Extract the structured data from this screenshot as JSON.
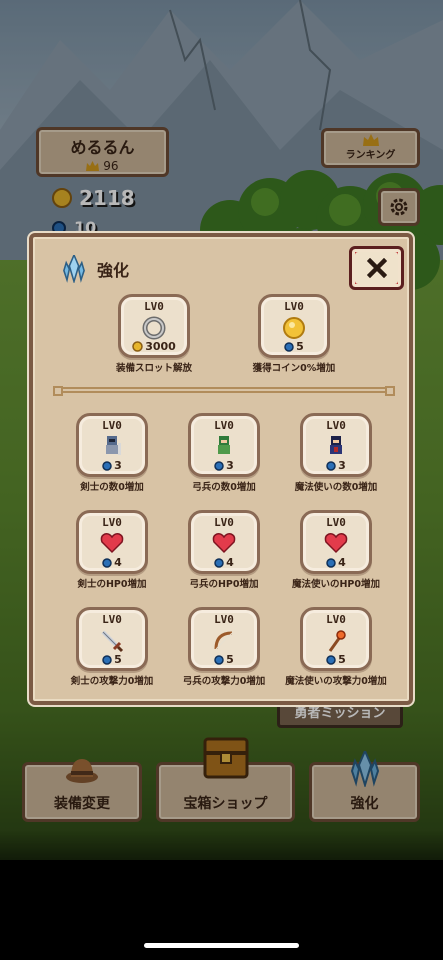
{
  "player": {
    "name": "めるるん",
    "level": "96"
  },
  "currency": {
    "coins": "2118",
    "gems": "10"
  },
  "ranking": {
    "label": "ランキング"
  },
  "mission": {
    "label": "勇者ミッション"
  },
  "nav": {
    "equip": "装備変更",
    "shop": "宝箱ショップ",
    "enhance": "強化"
  },
  "dialog": {
    "title": "強化",
    "top": [
      {
        "level": "LV0",
        "cost": "3000",
        "caption": "装備スロット解放",
        "currency": "coin",
        "icon": "ring-icon"
      },
      {
        "level": "LV0",
        "cost": "5",
        "caption": "獲得コイン0%増加",
        "currency": "gem",
        "icon": "coin-icon"
      }
    ],
    "grid": [
      {
        "level": "LV0",
        "cost": "3",
        "caption": "剣士の数0増加",
        "icon": "swordsman-icon"
      },
      {
        "level": "LV0",
        "cost": "3",
        "caption": "弓兵の数0増加",
        "icon": "archer-icon"
      },
      {
        "level": "LV0",
        "cost": "3",
        "caption": "魔法使いの数0増加",
        "icon": "mage-icon"
      },
      {
        "level": "LV0",
        "cost": "4",
        "caption": "剣士のHP0増加",
        "icon": "heart-icon"
      },
      {
        "level": "LV0",
        "cost": "4",
        "caption": "弓兵のHP0増加",
        "icon": "heart-icon"
      },
      {
        "level": "LV0",
        "cost": "4",
        "caption": "魔法使いのHP0増加",
        "icon": "heart-icon"
      },
      {
        "level": "LV0",
        "cost": "5",
        "caption": "剣士の攻撃力0増加",
        "icon": "sword-icon"
      },
      {
        "level": "LV0",
        "cost": "5",
        "caption": "弓兵の攻撃力0増加",
        "icon": "bow-icon"
      },
      {
        "level": "LV0",
        "cost": "5",
        "caption": "魔法使いの攻撃力0増加",
        "icon": "staff-icon"
      }
    ]
  },
  "colors": {
    "panel": "#d8c3a5",
    "border": "#7b5a44",
    "close": "#c23a3a",
    "gem": "#2b6fb6",
    "coin": "#f2c238"
  }
}
